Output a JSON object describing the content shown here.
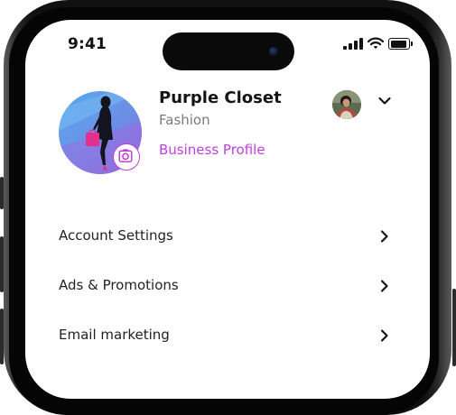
{
  "status_bar": {
    "time": "9:41"
  },
  "profile": {
    "name": "Purple Closet",
    "category": "Fashion",
    "business_link": "Business Profile"
  },
  "menu": {
    "items": [
      {
        "label": "Account Settings"
      },
      {
        "label": "Ads & Promotions"
      },
      {
        "label": "Email marketing"
      }
    ]
  },
  "colors": {
    "accent": "#BF3FE0",
    "text_primary": "#151515",
    "text_secondary": "#7A7A7A",
    "background": "#FFFFFF"
  },
  "icons": {
    "camera_badge": "camera-icon",
    "account_switch": "chevron-down-icon",
    "menu_chevron": "chevron-right-icon"
  }
}
